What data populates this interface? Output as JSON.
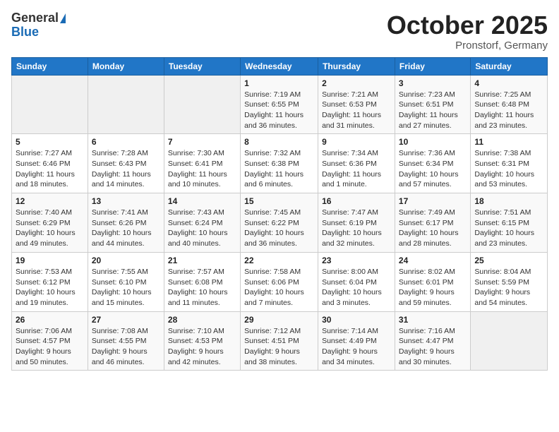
{
  "header": {
    "logo_general": "General",
    "logo_blue": "Blue",
    "month_title": "October 2025",
    "location": "Pronstorf, Germany"
  },
  "weekdays": [
    "Sunday",
    "Monday",
    "Tuesday",
    "Wednesday",
    "Thursday",
    "Friday",
    "Saturday"
  ],
  "weeks": [
    [
      {
        "day": "",
        "info": ""
      },
      {
        "day": "",
        "info": ""
      },
      {
        "day": "",
        "info": ""
      },
      {
        "day": "1",
        "info": "Sunrise: 7:19 AM\nSunset: 6:55 PM\nDaylight: 11 hours and 36 minutes."
      },
      {
        "day": "2",
        "info": "Sunrise: 7:21 AM\nSunset: 6:53 PM\nDaylight: 11 hours and 31 minutes."
      },
      {
        "day": "3",
        "info": "Sunrise: 7:23 AM\nSunset: 6:51 PM\nDaylight: 11 hours and 27 minutes."
      },
      {
        "day": "4",
        "info": "Sunrise: 7:25 AM\nSunset: 6:48 PM\nDaylight: 11 hours and 23 minutes."
      }
    ],
    [
      {
        "day": "5",
        "info": "Sunrise: 7:27 AM\nSunset: 6:46 PM\nDaylight: 11 hours and 18 minutes."
      },
      {
        "day": "6",
        "info": "Sunrise: 7:28 AM\nSunset: 6:43 PM\nDaylight: 11 hours and 14 minutes."
      },
      {
        "day": "7",
        "info": "Sunrise: 7:30 AM\nSunset: 6:41 PM\nDaylight: 11 hours and 10 minutes."
      },
      {
        "day": "8",
        "info": "Sunrise: 7:32 AM\nSunset: 6:38 PM\nDaylight: 11 hours and 6 minutes."
      },
      {
        "day": "9",
        "info": "Sunrise: 7:34 AM\nSunset: 6:36 PM\nDaylight: 11 hours and 1 minute."
      },
      {
        "day": "10",
        "info": "Sunrise: 7:36 AM\nSunset: 6:34 PM\nDaylight: 10 hours and 57 minutes."
      },
      {
        "day": "11",
        "info": "Sunrise: 7:38 AM\nSunset: 6:31 PM\nDaylight: 10 hours and 53 minutes."
      }
    ],
    [
      {
        "day": "12",
        "info": "Sunrise: 7:40 AM\nSunset: 6:29 PM\nDaylight: 10 hours and 49 minutes."
      },
      {
        "day": "13",
        "info": "Sunrise: 7:41 AM\nSunset: 6:26 PM\nDaylight: 10 hours and 44 minutes."
      },
      {
        "day": "14",
        "info": "Sunrise: 7:43 AM\nSunset: 6:24 PM\nDaylight: 10 hours and 40 minutes."
      },
      {
        "day": "15",
        "info": "Sunrise: 7:45 AM\nSunset: 6:22 PM\nDaylight: 10 hours and 36 minutes."
      },
      {
        "day": "16",
        "info": "Sunrise: 7:47 AM\nSunset: 6:19 PM\nDaylight: 10 hours and 32 minutes."
      },
      {
        "day": "17",
        "info": "Sunrise: 7:49 AM\nSunset: 6:17 PM\nDaylight: 10 hours and 28 minutes."
      },
      {
        "day": "18",
        "info": "Sunrise: 7:51 AM\nSunset: 6:15 PM\nDaylight: 10 hours and 23 minutes."
      }
    ],
    [
      {
        "day": "19",
        "info": "Sunrise: 7:53 AM\nSunset: 6:12 PM\nDaylight: 10 hours and 19 minutes."
      },
      {
        "day": "20",
        "info": "Sunrise: 7:55 AM\nSunset: 6:10 PM\nDaylight: 10 hours and 15 minutes."
      },
      {
        "day": "21",
        "info": "Sunrise: 7:57 AM\nSunset: 6:08 PM\nDaylight: 10 hours and 11 minutes."
      },
      {
        "day": "22",
        "info": "Sunrise: 7:58 AM\nSunset: 6:06 PM\nDaylight: 10 hours and 7 minutes."
      },
      {
        "day": "23",
        "info": "Sunrise: 8:00 AM\nSunset: 6:04 PM\nDaylight: 10 hours and 3 minutes."
      },
      {
        "day": "24",
        "info": "Sunrise: 8:02 AM\nSunset: 6:01 PM\nDaylight: 9 hours and 59 minutes."
      },
      {
        "day": "25",
        "info": "Sunrise: 8:04 AM\nSunset: 5:59 PM\nDaylight: 9 hours and 54 minutes."
      }
    ],
    [
      {
        "day": "26",
        "info": "Sunrise: 7:06 AM\nSunset: 4:57 PM\nDaylight: 9 hours and 50 minutes."
      },
      {
        "day": "27",
        "info": "Sunrise: 7:08 AM\nSunset: 4:55 PM\nDaylight: 9 hours and 46 minutes."
      },
      {
        "day": "28",
        "info": "Sunrise: 7:10 AM\nSunset: 4:53 PM\nDaylight: 9 hours and 42 minutes."
      },
      {
        "day": "29",
        "info": "Sunrise: 7:12 AM\nSunset: 4:51 PM\nDaylight: 9 hours and 38 minutes."
      },
      {
        "day": "30",
        "info": "Sunrise: 7:14 AM\nSunset: 4:49 PM\nDaylight: 9 hours and 34 minutes."
      },
      {
        "day": "31",
        "info": "Sunrise: 7:16 AM\nSunset: 4:47 PM\nDaylight: 9 hours and 30 minutes."
      },
      {
        "day": "",
        "info": ""
      }
    ]
  ]
}
